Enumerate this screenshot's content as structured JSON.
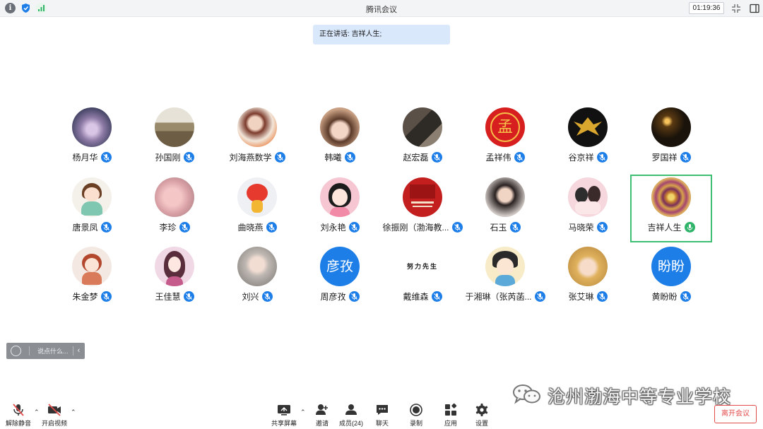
{
  "window": {
    "title": "腾讯会议",
    "timer": "01:19:36"
  },
  "speaking_banner": {
    "prefix": "正在讲话:",
    "speaker": "吉祥人生;"
  },
  "participants": [
    {
      "name": "杨月华",
      "avatar": "flower-photo"
    },
    {
      "name": "孙国刚",
      "avatar": "landscape-photo"
    },
    {
      "name": "刘海燕数学",
      "avatar": "person-photo"
    },
    {
      "name": "韩曦",
      "avatar": "child-photo"
    },
    {
      "name": "赵宏磊",
      "avatar": "room-photo"
    },
    {
      "name": "孟祥伟",
      "avatar": "seal-logo",
      "avatar_text": "孟"
    },
    {
      "name": "谷京祥",
      "avatar": "eagle-logo"
    },
    {
      "name": "罗国祥",
      "avatar": "lights-photo"
    },
    {
      "name": "唐景凤",
      "avatar": "cartoon-girl"
    },
    {
      "name": "李珍",
      "avatar": "baby-photo"
    },
    {
      "name": "曲晓燕",
      "avatar": "cartoon-mascot"
    },
    {
      "name": "刘永艳",
      "avatar": "cartoon-girl-pink"
    },
    {
      "name": "徐振刚（渤海教...",
      "avatar": "red-poster"
    },
    {
      "name": "石玉",
      "avatar": "woman-photo"
    },
    {
      "name": "马晓荣",
      "avatar": "cartoon-couple"
    },
    {
      "name": "吉祥人生",
      "avatar": "mandala-pattern",
      "active": true
    },
    {
      "name": "朱金梦",
      "avatar": "cartoon-girl-sketch"
    },
    {
      "name": "王佳慧",
      "avatar": "cartoon-woman"
    },
    {
      "name": "刘兴",
      "avatar": "baby-photo-gray"
    },
    {
      "name": "周彦孜",
      "avatar": "text-avatar",
      "avatar_text": "彦孜"
    },
    {
      "name": "戴维森",
      "avatar": "calligraphy",
      "avatar_text": "努力先生"
    },
    {
      "name": "于湘琳（张芮菡...",
      "avatar": "cartoon-boy"
    },
    {
      "name": "张艾琳",
      "avatar": "baby-hood-photo"
    },
    {
      "name": "黄盼盼",
      "avatar": "text-avatar",
      "avatar_text": "盼盼"
    }
  ],
  "chat": {
    "placeholder": "说点什么..."
  },
  "toolbar": {
    "unmute": "解除静音",
    "start_video": "开启视频",
    "share_screen": "共享屏幕",
    "invite": "邀请",
    "members": "成员(24)",
    "chat": "聊天",
    "record": "录制",
    "apps": "应用",
    "settings": "设置",
    "leave": "离开会议"
  },
  "watermark": {
    "text": "沧州渤海中等专业学校"
  },
  "colors": {
    "accent_blue": "#1e7ee8",
    "active_green": "#3fbf73",
    "speaking_mic_green": "#2fb46a",
    "leave_red": "#e34b4b",
    "banner_bg": "#d9e8fb"
  }
}
